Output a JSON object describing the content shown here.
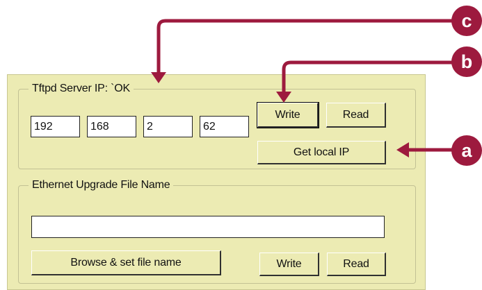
{
  "tftp_group": {
    "legend": "Tftpd Server IP: `OK",
    "ip": [
      "192",
      "168",
      "2",
      "62"
    ],
    "write_label": "Write",
    "read_label": "Read",
    "get_local_ip_label": "Get local IP"
  },
  "upgrade_group": {
    "legend": "Ethernet Upgrade File Name",
    "file_name_value": "",
    "browse_label": "Browse & set file name",
    "write_label": "Write",
    "read_label": "Read"
  },
  "callouts": {
    "a": "a",
    "b": "b",
    "c": "c"
  },
  "colors": {
    "panel_bg": "#ecebb3",
    "callout": "#9d1a3e"
  }
}
